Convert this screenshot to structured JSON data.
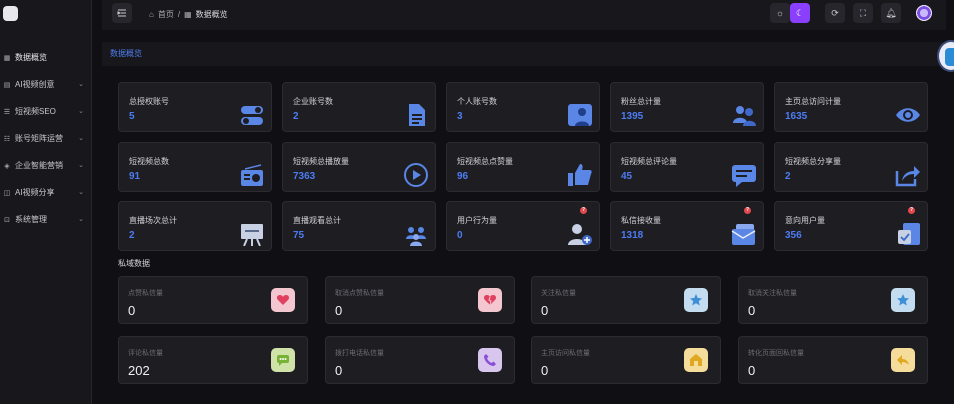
{
  "sidebar": {
    "items": [
      {
        "label": "数据概览",
        "icon": "grid-icon",
        "expandable": false
      },
      {
        "label": "AI视频创意",
        "icon": "doc-icon",
        "expandable": true
      },
      {
        "label": "短视频SEO",
        "icon": "list-icon",
        "expandable": true
      },
      {
        "label": "账号矩阵运营",
        "icon": "user-group-icon",
        "expandable": true
      },
      {
        "label": "企业智能营销",
        "icon": "megaphone-icon",
        "expandable": true
      },
      {
        "label": "AI视频分享",
        "icon": "share-icon",
        "expandable": true
      },
      {
        "label": "系统管理",
        "icon": "settings-icon",
        "expandable": true
      }
    ],
    "chevron": "⌄"
  },
  "header": {
    "breadcrumb_home": "首页",
    "breadcrumb_sep": "/",
    "breadcrumb_current": "数据概览"
  },
  "tabbar": {
    "active_tab": "数据概览"
  },
  "stats": [
    {
      "label": "总授权账号",
      "value": "5",
      "icon": "toggle-icon",
      "alert": false
    },
    {
      "label": "企业账号数",
      "value": "2",
      "icon": "document-icon",
      "alert": false
    },
    {
      "label": "个人账号数",
      "value": "3",
      "icon": "person-card-icon",
      "alert": false
    },
    {
      "label": "粉丝总计量",
      "value": "1395",
      "icon": "users-icon",
      "alert": false
    },
    {
      "label": "主页总访问计量",
      "value": "1635",
      "icon": "eye-icon",
      "alert": false
    },
    {
      "label": "短视频总数",
      "value": "91",
      "icon": "radio-icon",
      "alert": false
    },
    {
      "label": "短视频总播放量",
      "value": "7363",
      "icon": "play-icon",
      "alert": false
    },
    {
      "label": "短视频总点赞量",
      "value": "96",
      "icon": "thumbs-up-icon",
      "alert": false
    },
    {
      "label": "短视频总评论量",
      "value": "45",
      "icon": "comment-icon",
      "alert": false
    },
    {
      "label": "短视频总分享量",
      "value": "2",
      "icon": "share-arrow-icon",
      "alert": false
    },
    {
      "label": "直播场次总计",
      "value": "2",
      "icon": "easel-icon",
      "alert": false
    },
    {
      "label": "直播观看总计",
      "value": "75",
      "icon": "audience-icon",
      "alert": false
    },
    {
      "label": "用户行为量",
      "value": "0",
      "icon": "user-add-icon",
      "alert": true
    },
    {
      "label": "私信接收量",
      "value": "1318",
      "icon": "mail-icon",
      "alert": true
    },
    {
      "label": "意向用户量",
      "value": "356",
      "icon": "checklist-icon",
      "alert": true
    }
  ],
  "alert_mark": "?",
  "private_section_title": "私域数据",
  "private_stats": [
    {
      "label": "点赞私信量",
      "value": "0",
      "icon": "heart-icon",
      "bg": "#f4c6cf",
      "fg": "#e0405e"
    },
    {
      "label": "取消点赞私信量",
      "value": "0",
      "icon": "broken-heart-icon",
      "bg": "#f4c6cf",
      "fg": "#e0405e"
    },
    {
      "label": "关注私信量",
      "value": "0",
      "icon": "star-icon",
      "bg": "#c3dcef",
      "fg": "#3f8fd6"
    },
    {
      "label": "取消关注私信量",
      "value": "0",
      "icon": "star-icon",
      "bg": "#c3dcef",
      "fg": "#3f8fd6"
    },
    {
      "label": "评论私信量",
      "value": "202",
      "icon": "chat-icon",
      "bg": "#cfe3a8",
      "fg": "#77b135"
    },
    {
      "label": "拨打电话私信量",
      "value": "0",
      "icon": "phone-icon",
      "bg": "#d9c6ef",
      "fg": "#8a4fd8"
    },
    {
      "label": "主页访问私信量",
      "value": "0",
      "icon": "home-icon",
      "bg": "#f5dc9b",
      "fg": "#e0a820"
    },
    {
      "label": "转化页面回私信量",
      "value": "0",
      "icon": "reply-icon",
      "bg": "#f5dc9b",
      "fg": "#e0a820"
    }
  ]
}
